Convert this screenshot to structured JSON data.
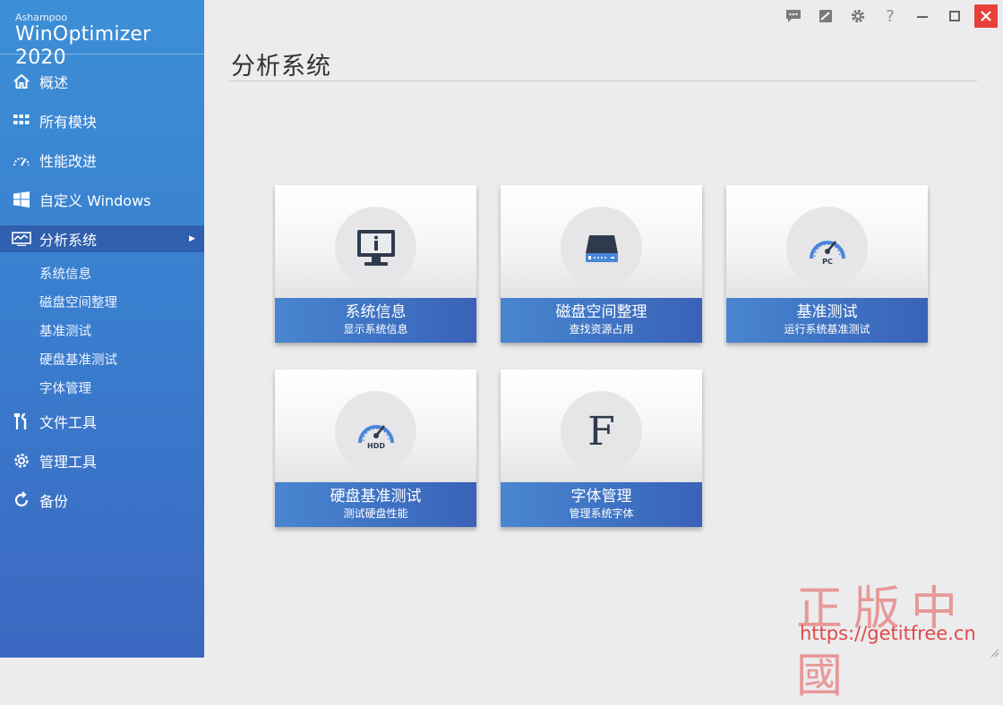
{
  "brand": {
    "vendor": "Ashampoo",
    "product": "WinOptimizer 2020"
  },
  "sidebar": {
    "items": [
      {
        "label": "概述",
        "icon": "home-icon"
      },
      {
        "label": "所有模块",
        "icon": "grid-icon"
      },
      {
        "label": "性能改进",
        "icon": "gauge-icon"
      },
      {
        "label": "自定义 Windows",
        "icon": "windows-icon"
      },
      {
        "label": "分析系统",
        "icon": "analysis-icon",
        "active": true
      }
    ],
    "sub_items": [
      "系统信息",
      "磁盘空间整理",
      "基准测试",
      "硬盘基准测试",
      "字体管理"
    ],
    "bottom_items": [
      {
        "label": "文件工具",
        "icon": "tools-icon"
      },
      {
        "label": "管理工具",
        "icon": "gear-icon"
      },
      {
        "label": "备份",
        "icon": "refresh-icon"
      }
    ]
  },
  "topbar": {
    "icons": [
      "feedback-icon",
      "skin-icon",
      "settings-icon",
      "help-icon",
      "minimize-icon",
      "maximize-icon",
      "close-icon"
    ],
    "help_glyph": "?"
  },
  "main": {
    "title": "分析系统",
    "tiles": [
      {
        "title": "系统信息",
        "subtitle": "显示系统信息",
        "icon": "monitor-info-icon"
      },
      {
        "title": "磁盘空间整理",
        "subtitle": "查找资源占用",
        "icon": "drive-icon"
      },
      {
        "title": "基准测试",
        "subtitle": "运行系统基准测试",
        "icon": "pc-gauge-icon",
        "icon_label": "PC"
      },
      {
        "title": "硬盘基准测试",
        "subtitle": "测试硬盘性能",
        "icon": "hdd-gauge-icon",
        "icon_label": "HDD"
      },
      {
        "title": "字体管理",
        "subtitle": "管理系统字体",
        "icon": "font-icon",
        "icon_label": "F"
      }
    ]
  },
  "watermark": {
    "chinese": "正版中國",
    "url": "https://getitfree.cn"
  },
  "colors": {
    "sidebar": "#3b7fd0",
    "band": "#3f74c4",
    "close": "#e8413a"
  }
}
